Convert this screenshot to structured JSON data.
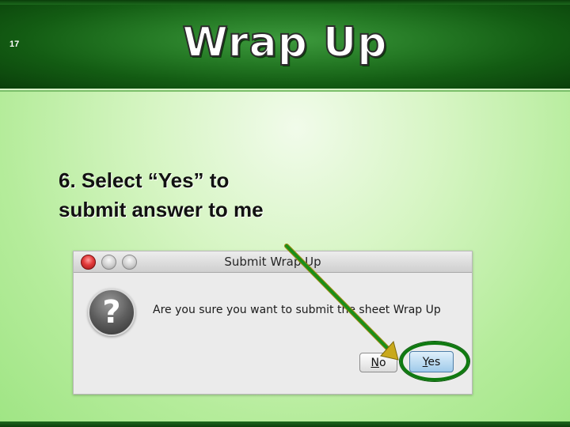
{
  "slide": {
    "number": "17",
    "title": "Wrap Up",
    "instruction_line1": "6. Select “Yes” to",
    "instruction_line2": "submit answer to me"
  },
  "dialog": {
    "title": "Submit Wrap Up",
    "message": "Are you sure you want to submit the sheet Wrap Up",
    "no_mnemonic": "N",
    "no_rest": "o",
    "yes_mnemonic": "Y",
    "yes_rest": "es",
    "icon": "question-icon"
  },
  "colors": {
    "header_green": "#1e6e1e",
    "background_light_green": "#c9f1b2",
    "annotation_arrow": "#1a8f1a",
    "annotation_ring": "#0f7a10",
    "close_button": "#e23a3a",
    "default_button": "#9fcaea"
  }
}
